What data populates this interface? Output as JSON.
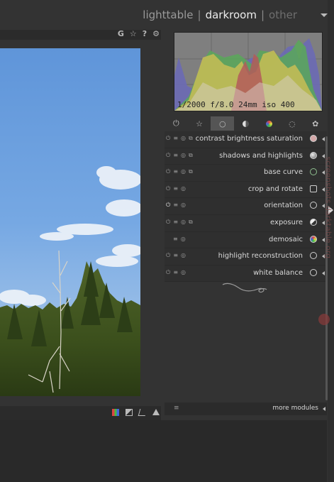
{
  "header": {
    "views": [
      "lighttable",
      "darkroom",
      "other"
    ],
    "separator": "|",
    "active_view": "darkroom"
  },
  "center_toolbar": {
    "icons": [
      "G",
      "☆",
      "?",
      "⚙"
    ]
  },
  "histogram": {
    "info": "1/2000 f/8.0 24mm iso 400"
  },
  "module_groups": [
    "power-icon",
    "star-icon",
    "circle-icon",
    "tone-icon",
    "color-icon",
    "correct-icon",
    "effect-icon"
  ],
  "modules": [
    {
      "label": "contrast brightness saturation",
      "icon": "contrast-icon"
    },
    {
      "label": "shadows and highlights",
      "icon": "shadows-icon"
    },
    {
      "label": "base curve",
      "icon": "curve-icon"
    },
    {
      "label": "crop and rotate",
      "icon": "crop-icon"
    },
    {
      "label": "orientation",
      "icon": "orientation-icon"
    },
    {
      "label": "exposure",
      "icon": "exposure-icon"
    },
    {
      "label": "demosaic",
      "icon": "demosaic-icon"
    },
    {
      "label": "highlight reconstruction",
      "icon": "highlight-icon"
    },
    {
      "label": "white balance",
      "icon": "white-balance-icon"
    }
  ],
  "more_modules": "more modules",
  "watermark": "screenshots.darktable.org"
}
